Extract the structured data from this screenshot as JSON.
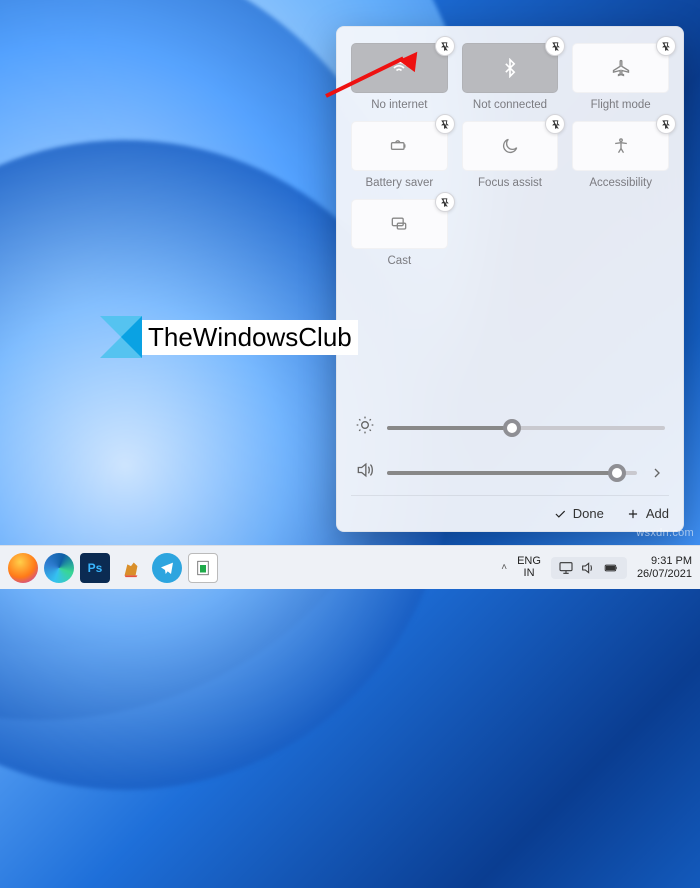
{
  "watermark_logo_text": "TheWindowsClub",
  "watermark_site": "wsxdn.com",
  "panel": {
    "tiles": [
      {
        "id": "wifi",
        "label": "No internet",
        "active": true
      },
      {
        "id": "bluetooth",
        "label": "Not connected",
        "active": true
      },
      {
        "id": "flight",
        "label": "Flight mode",
        "active": false
      },
      {
        "id": "battery",
        "label": "Battery saver",
        "active": false
      },
      {
        "id": "focus",
        "label": "Focus assist",
        "active": false
      },
      {
        "id": "accessibility",
        "label": "Accessibility",
        "active": false
      },
      {
        "id": "cast",
        "label": "Cast",
        "active": false
      }
    ],
    "brightness_percent": 45,
    "volume_percent": 92,
    "done_label": "Done",
    "add_label": "Add"
  },
  "taskbar": {
    "lang_top": "ENG",
    "lang_bottom": "IN",
    "time": "9:31 PM",
    "date": "26/07/2021"
  }
}
